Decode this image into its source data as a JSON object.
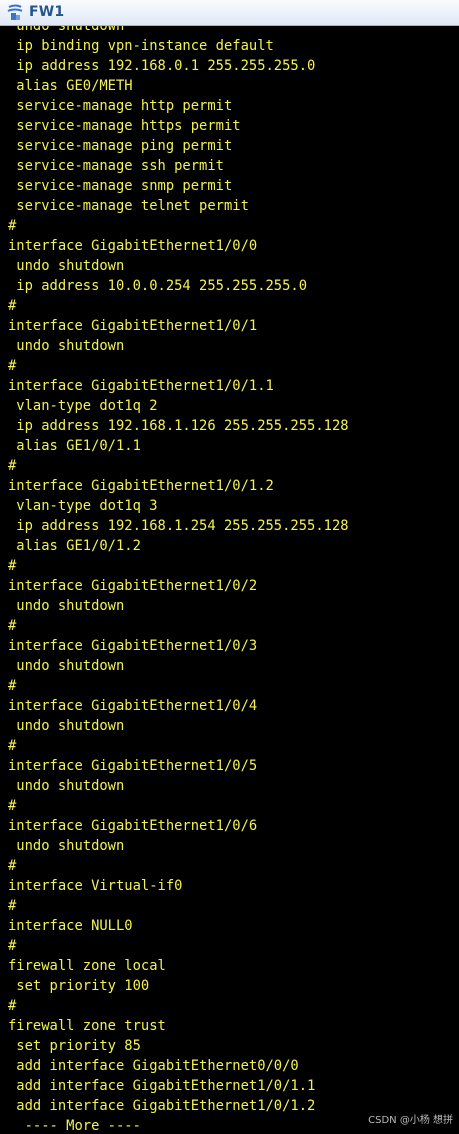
{
  "window": {
    "title": "FW1",
    "icon": "terminal-app-icon"
  },
  "terminal": {
    "lines": [
      " undo shutdown",
      " ip binding vpn-instance default",
      " ip address 192.168.0.1 255.255.255.0",
      " alias GE0/METH",
      " service-manage http permit",
      " service-manage https permit",
      " service-manage ping permit",
      " service-manage ssh permit",
      " service-manage snmp permit",
      " service-manage telnet permit",
      "#",
      "interface GigabitEthernet1/0/0",
      " undo shutdown",
      " ip address 10.0.0.254 255.255.255.0",
      "#",
      "interface GigabitEthernet1/0/1",
      " undo shutdown",
      "#",
      "interface GigabitEthernet1/0/1.1",
      " vlan-type dot1q 2",
      " ip address 192.168.1.126 255.255.255.128",
      " alias GE1/0/1.1",
      "#",
      "interface GigabitEthernet1/0/1.2",
      " vlan-type dot1q 3",
      " ip address 192.168.1.254 255.255.255.128",
      " alias GE1/0/1.2",
      "#",
      "interface GigabitEthernet1/0/2",
      " undo shutdown",
      "#",
      "interface GigabitEthernet1/0/3",
      " undo shutdown",
      "#",
      "interface GigabitEthernet1/0/4",
      " undo shutdown",
      "#",
      "interface GigabitEthernet1/0/5",
      " undo shutdown",
      "#",
      "interface GigabitEthernet1/0/6",
      " undo shutdown",
      "#",
      "interface Virtual-if0",
      "#",
      "interface NULL0",
      "#",
      "firewall zone local",
      " set priority 100",
      "#",
      "firewall zone trust",
      " set priority 85",
      " add interface GigabitEthernet0/0/0",
      " add interface GigabitEthernet1/0/1.1",
      " add interface GigabitEthernet1/0/1.2"
    ],
    "more_prompt": "  ---- More ----",
    "text_color": "#f2f254",
    "background_color": "#000000"
  },
  "watermark": {
    "text": "CSDN @小杨 想拼"
  }
}
